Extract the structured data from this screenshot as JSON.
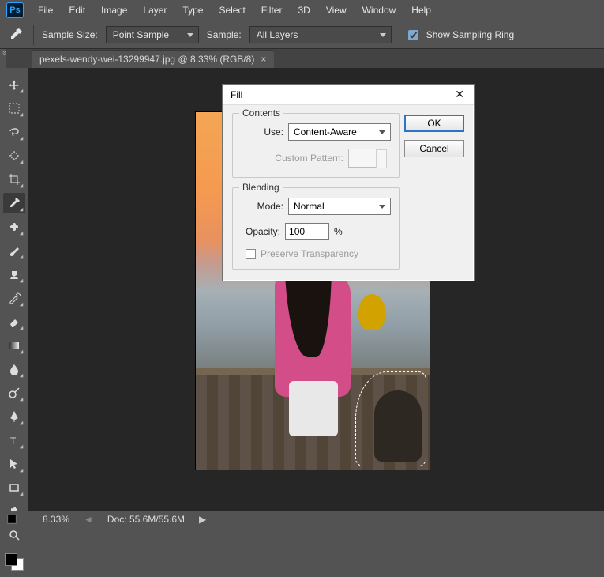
{
  "app": {
    "logo": "Ps"
  },
  "menu": [
    "File",
    "Edit",
    "Image",
    "Layer",
    "Type",
    "Select",
    "Filter",
    "3D",
    "View",
    "Window",
    "Help"
  ],
  "options": {
    "sample_size_label": "Sample Size:",
    "sample_size_value": "Point Sample",
    "sample_label": "Sample:",
    "sample_value": "All Layers",
    "show_ring_label": "Show Sampling Ring",
    "show_ring_checked": true
  },
  "document": {
    "tab_title": "pexels-wendy-wei-13299947.jpg @ 8.33% (RGB/8)",
    "tab_close": "×"
  },
  "status": {
    "zoom": "8.33%",
    "doc_label": "Doc:",
    "doc_value": "55.6M/55.6M"
  },
  "tools": [
    "move-tool",
    "marquee-tool",
    "lasso-tool",
    "quick-select-tool",
    "crop-tool",
    "eyedropper-tool",
    "healing-brush-tool",
    "brush-tool",
    "clone-stamp-tool",
    "history-brush-tool",
    "eraser-tool",
    "gradient-tool",
    "blur-tool",
    "dodge-tool",
    "pen-tool",
    "type-tool",
    "path-select-tool",
    "rectangle-tool",
    "hand-tool",
    "zoom-tool"
  ],
  "dialog": {
    "title": "Fill",
    "ok": "OK",
    "cancel": "Cancel",
    "contents_legend": "Contents",
    "use_label": "Use:",
    "use_value": "Content-Aware",
    "custom_pattern_label": "Custom Pattern:",
    "blending_legend": "Blending",
    "mode_label": "Mode:",
    "mode_value": "Normal",
    "opacity_label": "Opacity:",
    "opacity_value": "100",
    "opacity_unit": "%",
    "preserve_label": "Preserve Transparency"
  }
}
